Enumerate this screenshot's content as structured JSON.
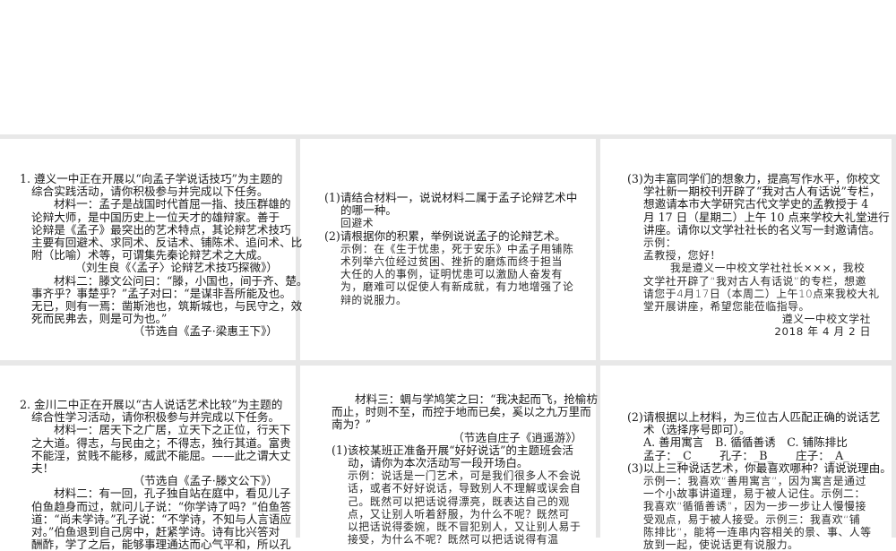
{
  "panels": [
    {
      "id": "slide-1",
      "lines": [
        {
          "kind": "q",
          "text": "1. 遵义一中正在开展以“向孟子学说话技巧”为主题的"
        },
        {
          "kind": "c",
          "text": "综合实践活动，请你积极参与并完成以下任务。"
        },
        {
          "kind": "m",
          "text": "材料一：孟子是战国时代首屈一指、技压群雄的"
        },
        {
          "kind": "c",
          "text": "论辩大师，是中国历史上一位天才的雄辩家。善于"
        },
        {
          "kind": "c",
          "text": "论辩是《孟子》最突出的艺术特点，其论辩艺术技巧"
        },
        {
          "kind": "c",
          "text": "主要有回避术、求同术、反诘术、铺陈术、追问术、比"
        },
        {
          "kind": "c",
          "text": "附（比喻）术等，可谓集先秦论辩艺术之大成。"
        },
        {
          "kind": "r",
          "text": "（刘生良《〈孟子〉论辩艺术技巧探微》）"
        },
        {
          "kind": "m",
          "text": "材料二：滕文公问曰：“滕，小国也，间于齐、楚。"
        },
        {
          "kind": "c",
          "text": "事齐乎？事楚乎？”孟子对曰：“是谋非吾所能及也。"
        },
        {
          "kind": "c",
          "text": "无已，则有一焉：凿斯池也，筑斯城也，与民守之，效"
        },
        {
          "kind": "c",
          "text": "死而民弗去，则是可为也。”"
        },
        {
          "kind": "r",
          "text": "（节选自《孟子·梁惠王下》）"
        }
      ]
    },
    {
      "id": "slide-2",
      "lines": [
        {
          "kind": "q",
          "text": "(1)请结合材料一，说说材料二属于孟子论辩艺术中"
        },
        {
          "kind": "s",
          "text": "的哪一种。"
        },
        {
          "kind": "a",
          "text": "回避术"
        },
        {
          "kind": "q",
          "text": "(2)请根据你的积累，举例说说孟子的论辩艺术。"
        },
        {
          "kind": "a",
          "text": "示例：在《生于忧患，死于安乐》中孟子用铺陈"
        },
        {
          "kind": "a",
          "text": "术列举六位经过贫困、挫折的磨炼而终于担当"
        },
        {
          "kind": "a",
          "text": "大任的人的事例，证明忧患可以激励人奋发有"
        },
        {
          "kind": "a",
          "text": "为，磨难可以促使人有新成就，有力地增强了论"
        },
        {
          "kind": "a",
          "text": "辩的说服力。"
        }
      ]
    },
    {
      "id": "slide-3",
      "lines": [
        {
          "kind": "q",
          "text": "(3)为丰富同学们的想象力，提高写作水平，你校文"
        },
        {
          "kind": "s",
          "text": "学社新一期校刊开辟了“我对古人有话说”专栏，"
        },
        {
          "kind": "s",
          "text": "想邀请本市大学研究古代文学史的孟教授于 4"
        },
        {
          "kind": "s",
          "text": "月 17 日（星期二）上午 10 点来学校大礼堂进行"
        },
        {
          "kind": "s",
          "text": "讲座。请你以文学社社长的名义写一封邀请信。"
        },
        {
          "kind": "a",
          "text": "示例："
        },
        {
          "kind": "a",
          "text": "孟教授，您好！"
        },
        {
          "kind": "ai",
          "text": "我是遵义一中校文学社社长×××，我校"
        },
        {
          "kind": "a",
          "text": "文学社开辟了“我对古人有话说”的专栏，想邀"
        },
        {
          "kind": "a",
          "text": "请您于4月17日（本周二）上午10点来我校大礼"
        },
        {
          "kind": "a",
          "text": "堂开展讲座，希望您能莅临指导。"
        },
        {
          "kind": "ar",
          "text": "遵义一中校文学社"
        },
        {
          "kind": "ar",
          "text": "2018 年 4 月 2 日"
        }
      ]
    },
    {
      "id": "slide-4",
      "lines": [
        {
          "kind": "q",
          "text": "2. 金川二中正在开展以“古人说话艺术比较”为主题的"
        },
        {
          "kind": "c",
          "text": "综合性学习活动，请你积极参与并完成以下任务。"
        },
        {
          "kind": "m",
          "text": "材料一：居天下之广居，立天下之正位，行天下"
        },
        {
          "kind": "c",
          "text": "之大道。得志，与民由之；不得志，独行其道。富贵"
        },
        {
          "kind": "c",
          "text": "不能淫，贫贱不能移，威武不能屈。——此之谓大丈"
        },
        {
          "kind": "c",
          "text": "夫！"
        },
        {
          "kind": "r",
          "text": "（节选自《孟子·滕文公下》）"
        },
        {
          "kind": "m",
          "text": "材料二：有一回，孔子独自站在庭中，看见儿子"
        },
        {
          "kind": "c",
          "text": "伯鱼趋身而过，就问儿子说：“你学诗了吗？”伯鱼答"
        },
        {
          "kind": "c",
          "text": "道：“尚未学诗。”孔子说：“不学诗，不知与人言语应"
        },
        {
          "kind": "c",
          "text": "对。”伯鱼退到自己房中，赶紧学诗。诗有比兴答对"
        },
        {
          "kind": "c",
          "text": "酬酢，学了之后，能够事理通达而心气平和，所以孔"
        }
      ]
    },
    {
      "id": "slide-5",
      "lines": [
        {
          "kind": "m",
          "text": "材料三：蜩与学鸠笑之曰：“我决起而飞，抢榆枋"
        },
        {
          "kind": "c",
          "text": "而止，时则不至，而控于地而已矣，奚以之九万里而"
        },
        {
          "kind": "c",
          "text": "南为？”"
        },
        {
          "kind": "r",
          "text": "（节选自庄子《逍遥游》）"
        },
        {
          "kind": "q",
          "text": "(1)该校某班正准备开展“好好说话”的主题班会活"
        },
        {
          "kind": "s",
          "text": "动，请你为本次活动写一段开场白。"
        },
        {
          "kind": "a",
          "text": "示例：说话是一门艺术，可是我们很多人不会说"
        },
        {
          "kind": "a",
          "text": "话，或者不好好说话，导致别人不理解或误会自"
        },
        {
          "kind": "a",
          "text": "己。既然可以把话说得漂亮，既表达自己的观"
        },
        {
          "kind": "a",
          "text": "点，又让别人听着舒服，为什么不呢？既然可"
        },
        {
          "kind": "a",
          "text": "以把话说得委婉，既不冒犯别人，又让别人易于"
        },
        {
          "kind": "a",
          "text": "接受，为什么不呢？既然可以把话说得有温"
        }
      ]
    },
    {
      "id": "slide-6",
      "lines": [
        {
          "kind": "q",
          "text": "(2)请根据以上材料，为三位古人匹配正确的说话艺"
        },
        {
          "kind": "s",
          "text": "术（选择序号即可）。"
        },
        {
          "kind": "s",
          "text": "A. 善用寓言　B. 循循善诱　C. 铺陈排比"
        },
        {
          "kind": "s",
          "text": "孟子：_C_　　孔子：_B_　　庄子：_A_"
        },
        {
          "kind": "q",
          "text": "(3)以上三种说话艺术，你最喜欢哪种？请说说理由。"
        },
        {
          "kind": "a",
          "text": "示例一：我喜欢“善用寓言”，因为寓言是通过"
        },
        {
          "kind": "a",
          "text": "一个小故事讲道理，易于被人记住。示例二："
        },
        {
          "kind": "a",
          "text": "我喜欢“循循善诱”，因为一步一步让人慢慢接"
        },
        {
          "kind": "a",
          "text": "受观点，易于被人接受。示例三：我喜欢“铺"
        },
        {
          "kind": "a",
          "text": "陈排比”，能将一连串内容相关的景、事、人等"
        },
        {
          "kind": "a",
          "text": "放到一起，使说话更有说服力。"
        }
      ]
    }
  ]
}
